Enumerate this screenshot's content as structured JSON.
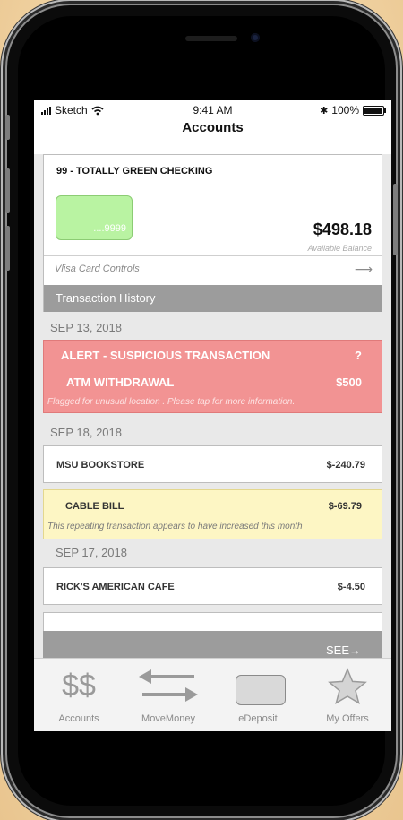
{
  "status": {
    "carrier": "Sketch",
    "time": "9:41 AM",
    "battery": "100%"
  },
  "header": {
    "title": "Accounts"
  },
  "account": {
    "name": "99 - TOTALLY GREEN CHECKING",
    "card_number": "....9999",
    "balance": "$498.18",
    "balance_label": "Available Balance",
    "card_controls": "Vlisa Card Controls",
    "transaction_history": "Transaction History"
  },
  "dates": [
    "SEP 13, 2018",
    "SEP 18, 2018",
    "SEP 17, 2018"
  ],
  "alert": {
    "title": "ALERT - SUSPICIOUS TRANSACTION",
    "help": "?",
    "name": "ATM WITHDRAWAL",
    "amount": "$500",
    "message": "Flagged for unusual location . Please tap for more information."
  },
  "transactions": [
    {
      "name": "MSU BOOKSTORE",
      "amount": "$-240.79"
    },
    {
      "name": "CABLE BILL",
      "amount": "$-69.79",
      "note": "This repeating transaction appears to have increased this month"
    },
    {
      "name": "RICK'S AMERICAN CAFE",
      "amount": "$-4.50"
    }
  ],
  "see_more": "SEE MORE",
  "tabs": [
    {
      "label": "Accounts",
      "icon": "dollar-icon",
      "glyph": "$$"
    },
    {
      "label": "MoveMoney",
      "icon": "transfer-arrows-icon"
    },
    {
      "label": "eDeposit",
      "icon": "card-icon"
    },
    {
      "label": "My Offers",
      "icon": "star-icon"
    }
  ],
  "colors": {
    "alert": "#f29393",
    "warning": "#fdf6c4",
    "card": "#b9f3a2",
    "bar": "#9c9c9c"
  }
}
